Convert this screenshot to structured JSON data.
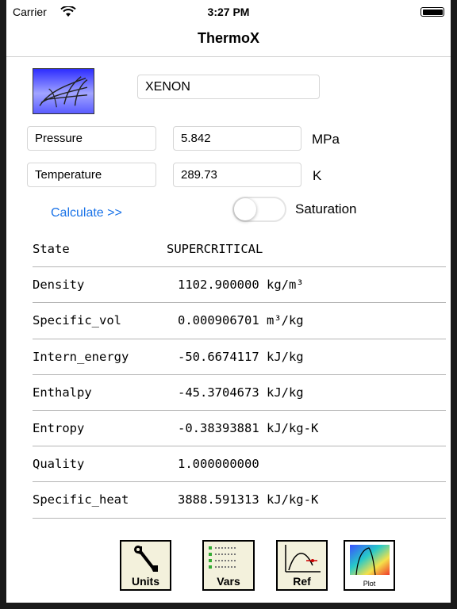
{
  "status_bar": {
    "carrier": "Carrier",
    "time": "3:27 PM"
  },
  "nav": {
    "title": "ThermoX"
  },
  "fluid": {
    "name": "XENON"
  },
  "inputs": {
    "pressure": {
      "label": "Pressure",
      "value": "5.842",
      "unit": "MPa"
    },
    "temperature": {
      "label": "Temperature",
      "value": "289.73",
      "unit": "K"
    }
  },
  "actions": {
    "calculate": "Calculate >>",
    "saturation_label": "Saturation",
    "saturation_on": false
  },
  "results": {
    "state": {
      "label": "State",
      "value": "SUPERCRITICAL"
    },
    "rows": [
      {
        "label": "Density",
        "value": "1102.900000 kg/m³"
      },
      {
        "label": "Specific_vol",
        "value": "0.000906701 m³/kg"
      },
      {
        "label": "Intern_energy",
        "value": "-50.6674117 kJ/kg"
      },
      {
        "label": "Enthalpy",
        "value": "-45.3704673 kJ/kg"
      },
      {
        "label": "Entropy",
        "value": "-0.38393881 kJ/kg-K"
      },
      {
        "label": "Quality",
        "value": "1.000000000"
      },
      {
        "label": "Specific_heat",
        "value": "3888.591313 kJ/kg-K"
      }
    ]
  },
  "toolbar": {
    "units": "Units",
    "vars": "Vars",
    "ref": "Ref",
    "plot": "Plot"
  },
  "colors": {
    "link": "#1a73e8",
    "icon_blue": "#2d2dff",
    "toolbar_bg": "#f3f1dc"
  }
}
